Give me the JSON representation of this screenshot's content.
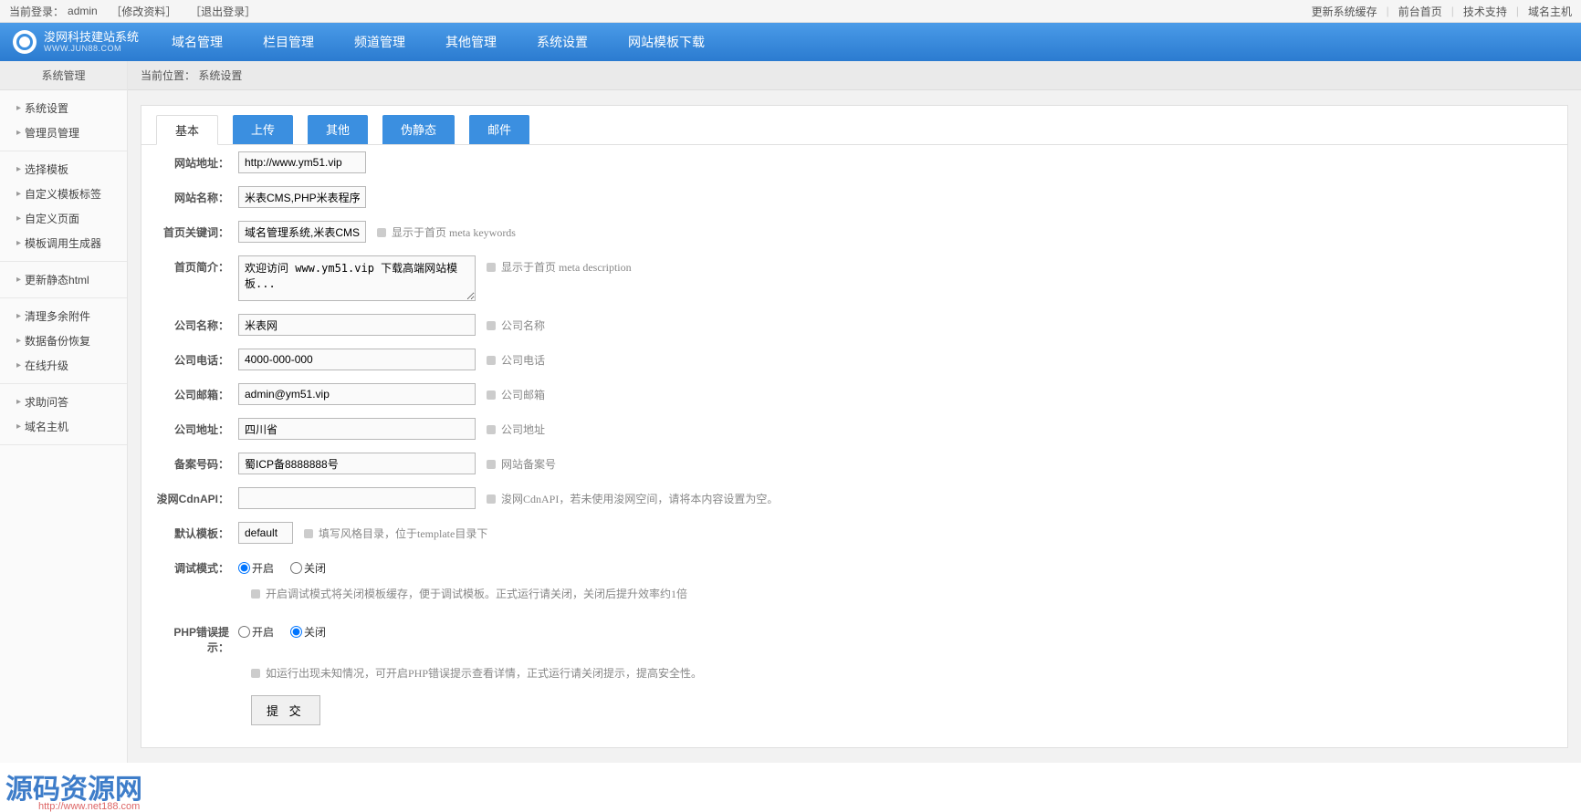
{
  "topbar": {
    "login_label": "当前登录：",
    "login_user": "admin",
    "edit_profile": "［修改资料］",
    "logout": "［退出登录］",
    "refresh_cache": "更新系统缓存",
    "front_home": "前台首页",
    "tech_support": "技术支持",
    "domain_host": "域名主机"
  },
  "nav": {
    "logo_title": "浚网科技建站系统",
    "logo_sub": "WWW.JUN88.COM",
    "items": [
      "域名管理",
      "栏目管理",
      "频道管理",
      "其他管理",
      "系统设置",
      "网站模板下载"
    ]
  },
  "sidebar": {
    "title": "系统管理",
    "groups": [
      [
        "系统设置",
        "管理员管理"
      ],
      [
        "选择模板",
        "自定义模板标签",
        "自定义页面",
        "模板调用生成器"
      ],
      [
        "更新静态html"
      ],
      [
        "清理多余附件",
        "数据备份恢复",
        "在线升级"
      ],
      [
        "求助问答",
        "域名主机"
      ]
    ]
  },
  "breadcrumb": {
    "prefix": "当前位置：",
    "current": "系统设置"
  },
  "tabs": [
    "基本",
    "上传",
    "其他",
    "伪静态",
    "邮件"
  ],
  "form": {
    "site_url_label": "网站地址：",
    "site_url_value": "http://www.ym51.vip",
    "site_name_label": "网站名称：",
    "site_name_value": "米表CMS,PHP米表程序,htr",
    "keywords_label": "首页关键词：",
    "keywords_value": "域名管理系统,米表CMS,汁",
    "keywords_hint": "显示于首页 meta keywords",
    "desc_label": "首页简介：",
    "desc_value": "欢迎访问 www.ym51.vip 下载高端网站模板...",
    "desc_hint": "显示于首页 meta description",
    "company_name_label": "公司名称：",
    "company_name_value": "米表网",
    "company_name_hint": "公司名称",
    "company_tel_label": "公司电话：",
    "company_tel_value": "4000-000-000",
    "company_tel_hint": "公司电话",
    "company_mail_label": "公司邮箱：",
    "company_mail_value": "admin@ym51.vip",
    "company_mail_hint": "公司邮箱",
    "company_addr_label": "公司地址：",
    "company_addr_value": "四川省",
    "company_addr_hint": "公司地址",
    "icp_label": "备案号码：",
    "icp_value": "蜀ICP备8888888号",
    "icp_hint": "网站备案号",
    "cdn_label": "浚网CdnAPI：",
    "cdn_value": "",
    "cdn_hint": "浚网CdnAPI，若未使用浚网空间，请将本内容设置为空。",
    "tpl_label": "默认模板：",
    "tpl_value": "default",
    "tpl_hint": "填写风格目录，位于template目录下",
    "debug_label": "调试模式：",
    "debug_on": "开启",
    "debug_off": "关闭",
    "debug_desc": "开启调试模式将关闭模板缓存，便于调试模板。正式运行请关闭，关闭后提升效率约1倍",
    "php_err_label": "PHP错误提示：",
    "php_on": "开启",
    "php_off": "关闭",
    "php_desc": "如运行出现未知情况，可开启PHP错误提示查看详情，正式运行请关闭提示，提高安全性。",
    "submit": "提 交"
  },
  "watermark": {
    "text": "源码资源网",
    "url": "http://www.net188.com"
  }
}
